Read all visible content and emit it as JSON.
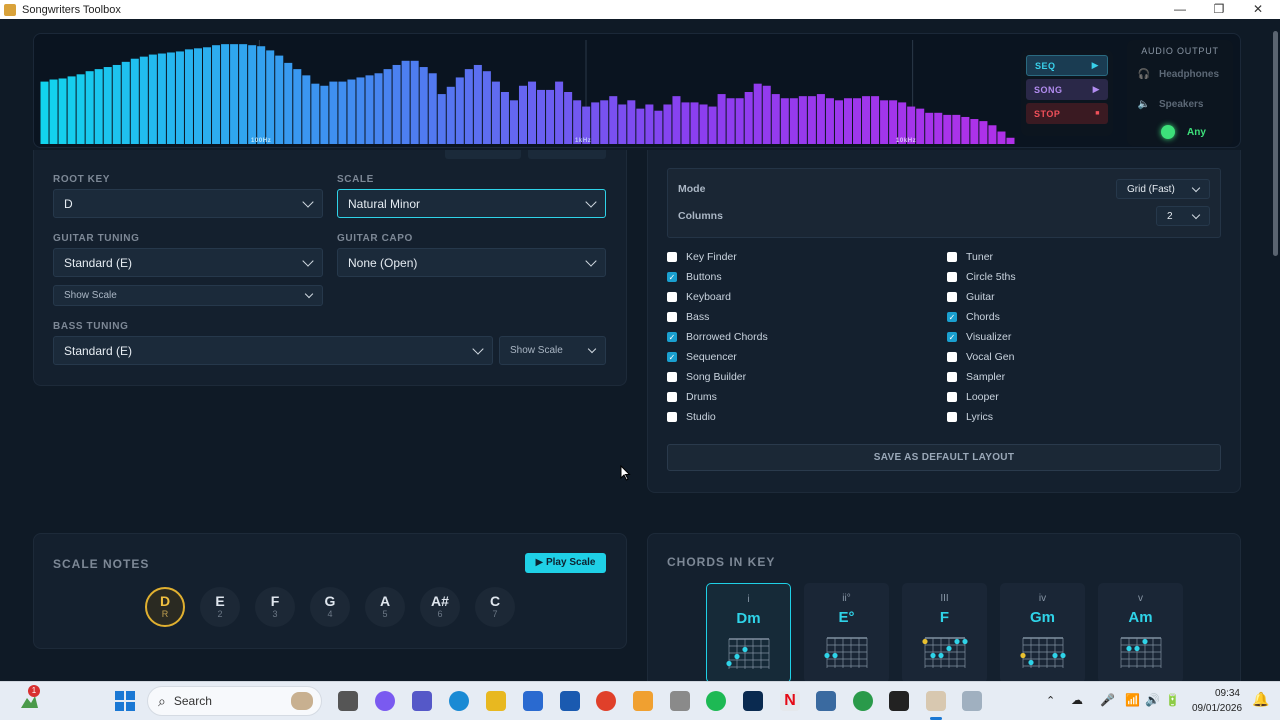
{
  "window": {
    "title": "Songwriters Toolbox",
    "minimize": "—",
    "maximize": "❐",
    "close": "✕"
  },
  "visualizer": {
    "freq_labels": [
      "100Hz",
      "1kHz",
      "10kHz"
    ],
    "levels": [
      0.6,
      0.62,
      0.63,
      0.65,
      0.67,
      0.7,
      0.72,
      0.74,
      0.76,
      0.79,
      0.82,
      0.84,
      0.86,
      0.87,
      0.88,
      0.89,
      0.91,
      0.92,
      0.93,
      0.95,
      0.96,
      0.96,
      0.96,
      0.95,
      0.94,
      0.9,
      0.85,
      0.78,
      0.72,
      0.66,
      0.58,
      0.56,
      0.6,
      0.6,
      0.62,
      0.64,
      0.66,
      0.68,
      0.72,
      0.76,
      0.8,
      0.8,
      0.74,
      0.68,
      0.48,
      0.55,
      0.64,
      0.72,
      0.76,
      0.7,
      0.6,
      0.5,
      0.42,
      0.56,
      0.6,
      0.52,
      0.52,
      0.6,
      0.5,
      0.42,
      0.36,
      0.4,
      0.42,
      0.46,
      0.38,
      0.42,
      0.34,
      0.38,
      0.32,
      0.38,
      0.46,
      0.4,
      0.4,
      0.38,
      0.36,
      0.48,
      0.44,
      0.44,
      0.5,
      0.58,
      0.56,
      0.48,
      0.44,
      0.44,
      0.46,
      0.46,
      0.48,
      0.44,
      0.42,
      0.44,
      0.44,
      0.46,
      0.46,
      0.42,
      0.42,
      0.4,
      0.36,
      0.34,
      0.3,
      0.3,
      0.28,
      0.28,
      0.26,
      0.24,
      0.22,
      0.18,
      0.12,
      0.06
    ],
    "colors": [
      "#12d4ee",
      "#4488f0",
      "#8a3ff0",
      "#b030e8"
    ]
  },
  "transport": {
    "seq": "SEQ",
    "song": "SONG",
    "stop": "STOP",
    "play_icon": "▶",
    "stop_icon": "■"
  },
  "audio_output": {
    "title": "AUDIO OUTPUT",
    "headphones": "Headphones",
    "speakers": "Speakers",
    "any": "Any"
  },
  "settings": {
    "root_key_label": "ROOT KEY",
    "root_key": "D",
    "scale_label": "SCALE",
    "scale": "Natural Minor",
    "guitar_tuning_label": "GUITAR TUNING",
    "guitar_tuning": "Standard (E)",
    "guitar_capo_label": "GUITAR CAPO",
    "guitar_capo": "None (Open)",
    "guitar_show": "Show Scale",
    "bass_tuning_label": "BASS TUNING",
    "bass_tuning": "Standard (E)",
    "bass_show": "Show Scale"
  },
  "layout": {
    "mode_label": "Mode",
    "mode": "Grid (Fast)",
    "columns_label": "Columns",
    "columns": "2",
    "modules_left": [
      {
        "label": "Key Finder",
        "checked": false
      },
      {
        "label": "Buttons",
        "checked": true
      },
      {
        "label": "Keyboard",
        "checked": false
      },
      {
        "label": "Bass",
        "checked": false
      },
      {
        "label": "Borrowed Chords",
        "checked": true
      },
      {
        "label": "Sequencer",
        "checked": true
      },
      {
        "label": "Song Builder",
        "checked": false
      },
      {
        "label": "Drums",
        "checked": false
      },
      {
        "label": "Studio",
        "checked": false
      }
    ],
    "modules_right": [
      {
        "label": "Tuner",
        "checked": false
      },
      {
        "label": "Circle 5ths",
        "checked": false
      },
      {
        "label": "Guitar",
        "checked": false
      },
      {
        "label": "Chords",
        "checked": true
      },
      {
        "label": "Visualizer",
        "checked": true
      },
      {
        "label": "Vocal Gen",
        "checked": false
      },
      {
        "label": "Sampler",
        "checked": false
      },
      {
        "label": "Looper",
        "checked": false
      },
      {
        "label": "Lyrics",
        "checked": false
      }
    ],
    "save_label": "SAVE AS DEFAULT LAYOUT"
  },
  "scale_notes": {
    "title": "SCALE NOTES",
    "play_label": "▶ Play Scale",
    "notes": [
      {
        "name": "D",
        "degree": "R"
      },
      {
        "name": "E",
        "degree": "2"
      },
      {
        "name": "F",
        "degree": "3"
      },
      {
        "name": "G",
        "degree": "4"
      },
      {
        "name": "A",
        "degree": "5"
      },
      {
        "name": "A#",
        "degree": "6"
      },
      {
        "name": "C",
        "degree": "7"
      }
    ]
  },
  "chords_in_key": {
    "title": "CHORDS IN KEY",
    "chords": [
      {
        "numeral": "i",
        "name": "Dm"
      },
      {
        "numeral": "ii°",
        "name": "E°"
      },
      {
        "numeral": "III",
        "name": "F"
      },
      {
        "numeral": "iv",
        "name": "Gm"
      },
      {
        "numeral": "v",
        "name": "Am"
      }
    ]
  },
  "taskbar": {
    "search": "Search",
    "time": "09:34",
    "date": "09/01/2026",
    "badge": "1"
  }
}
